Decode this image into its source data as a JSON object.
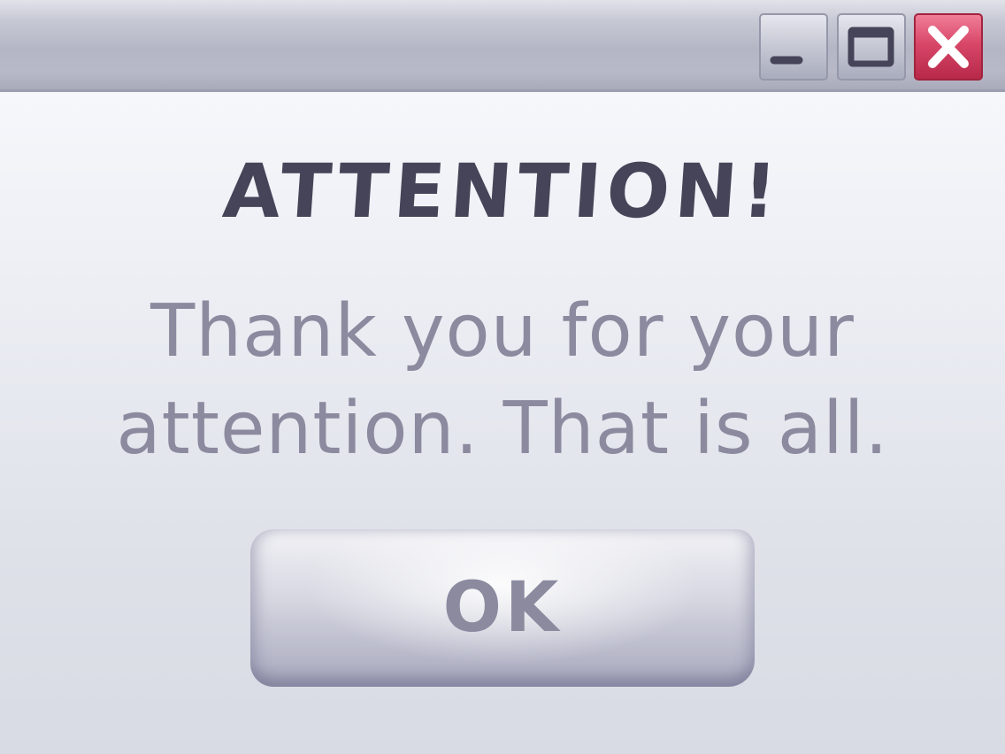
{
  "window": {
    "controls": {
      "minimize_icon": "minimize-icon",
      "maximize_icon": "maximize-icon",
      "close_icon": "close-icon"
    }
  },
  "dialog": {
    "heading": "ATTENTION!",
    "message_line1": "Thank you for your",
    "message_line2": "attention. That is all.",
    "ok_label": "OK"
  },
  "colors": {
    "heading": "#454458",
    "text": "#8b8a9f",
    "close_button": "#d84768",
    "titlebar": "#b4b6c5"
  }
}
